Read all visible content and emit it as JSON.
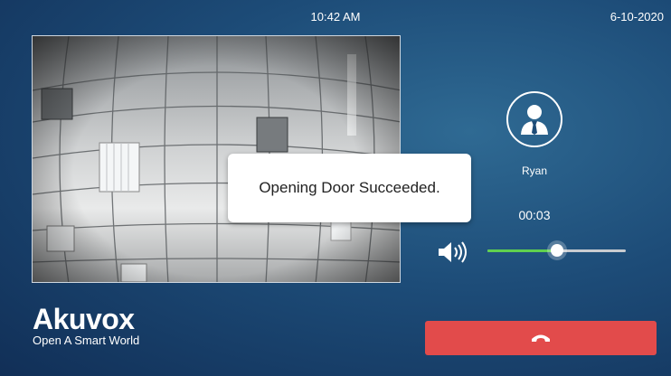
{
  "status_bar": {
    "time": "10:42 AM",
    "date": "6-10-2020"
  },
  "toast": {
    "message": "Opening Door Succeeded."
  },
  "caller": {
    "name": "Ryan",
    "duration": "00:03"
  },
  "volume": {
    "level_fraction": 0.5
  },
  "brand": {
    "logo": "Akuvox",
    "tagline": "Open A Smart World"
  },
  "icons": {
    "avatar": "person-icon",
    "volume": "speaker-icon",
    "hangup": "phone-hangup-icon"
  },
  "colors": {
    "accent_green": "#5fd14f",
    "hangup_red": "#e24b4b"
  }
}
